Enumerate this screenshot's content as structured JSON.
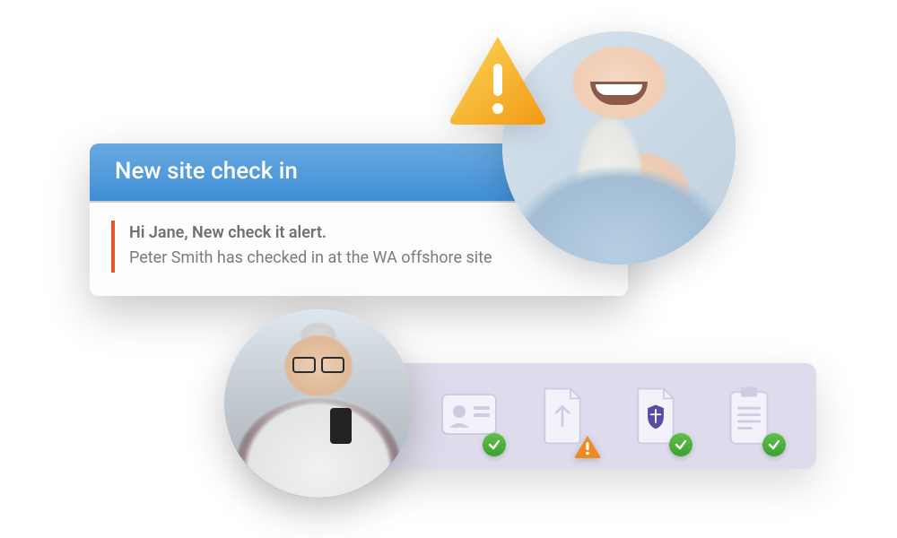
{
  "notification": {
    "title": "New site check in",
    "greeting": "Hi Jane, New check it alert.",
    "detail": "Peter Smith has checked in at the WA offshore site"
  },
  "icons": {
    "alert": "warning-triangle",
    "status": [
      {
        "name": "id-card",
        "state": "ok"
      },
      {
        "name": "upload-document",
        "state": "warn"
      },
      {
        "name": "shield-document",
        "state": "ok"
      },
      {
        "name": "clipboard",
        "state": "ok"
      }
    ]
  },
  "colors": {
    "header_blue": "#4a94d8",
    "accent_orange": "#e8562d",
    "strip_bg": "#dedbec",
    "ok_green": "#4caf3e",
    "warn_orange": "#ee8a1f",
    "alert_yellow": "#f7b733"
  }
}
